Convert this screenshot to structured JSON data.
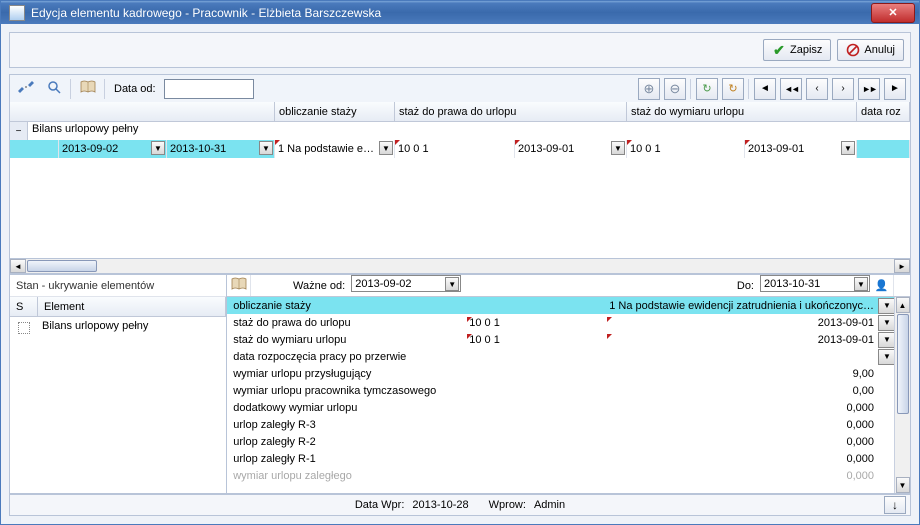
{
  "window": {
    "title": "Edycja elementu kadrowego - Pracownik - Elżbieta Barszczewska"
  },
  "actions": {
    "save": "Zapisz",
    "cancel": "Anuluj"
  },
  "toolbar": {
    "date_from_label": "Data od:",
    "date_from_value": ""
  },
  "grid": {
    "cols": {
      "c1": "",
      "c2": "obliczanie staży",
      "c3": "staż do prawa do urlopu",
      "c4": "staż do wymiaru urlopu",
      "c5": "data roz"
    },
    "bilans_label": "Bilans urlopowy pełny",
    "row": {
      "date_start": "2013-09-02",
      "date_end": "2013-10-31",
      "oblicz": "1 Na podstawie e…",
      "prawa1": "10  0  1",
      "prawa2": "2013-09-01",
      "wymiar1": "10  0  1",
      "wymiar2": "2013-09-01"
    }
  },
  "left": {
    "header": "Stan - ukrywanie elementów",
    "col_s": "S",
    "col_el": "Element",
    "row1": "Bilans urlopowy pełny"
  },
  "right": {
    "wazne_od_label": "Ważne od:",
    "wazne_od_value": "2013-09-02",
    "do_label": "Do:",
    "do_value": "2013-10-31",
    "rows": [
      {
        "k": "obliczanie staży",
        "v1": "",
        "v2": "1 Na podstawie ewidencji zatrudnienia i ukończonyc…",
        "sel": true,
        "dd": true
      },
      {
        "k": "staż do prawa do urlopu",
        "v1": "10  0  1",
        "v2": "2013-09-01",
        "red": true,
        "dd": true
      },
      {
        "k": "staż do wymiaru urlopu",
        "v1": "10  0  1",
        "v2": "2013-09-01",
        "red": true,
        "dd": true
      },
      {
        "k": "data rozpoczęcia pracy po przerwie",
        "v1": "",
        "v2": "",
        "dd": true
      },
      {
        "k": "wymiar urlopu przysługujący",
        "v1": "",
        "v2": "9,00"
      },
      {
        "k": "wymiar urlopu pracownika tymczasowego",
        "v1": "",
        "v2": "0,00"
      },
      {
        "k": "dodatkowy wymiar urlopu",
        "v1": "",
        "v2": "0,000"
      },
      {
        "k": "urlop zaległy R-3",
        "v1": "",
        "v2": "0,000"
      },
      {
        "k": "urlop zaległy R-2",
        "v1": "",
        "v2": "0,000"
      },
      {
        "k": "urlop zaległy R-1",
        "v1": "",
        "v2": "0,000"
      },
      {
        "k": "wymiar urlopu zaległego",
        "v1": "",
        "v2": "0,000",
        "cut": true
      }
    ]
  },
  "status": {
    "data_wpr_label": "Data Wpr:",
    "data_wpr_value": "2013-10-28",
    "wprow_label": "Wprow:",
    "wprow_value": "Admin"
  }
}
